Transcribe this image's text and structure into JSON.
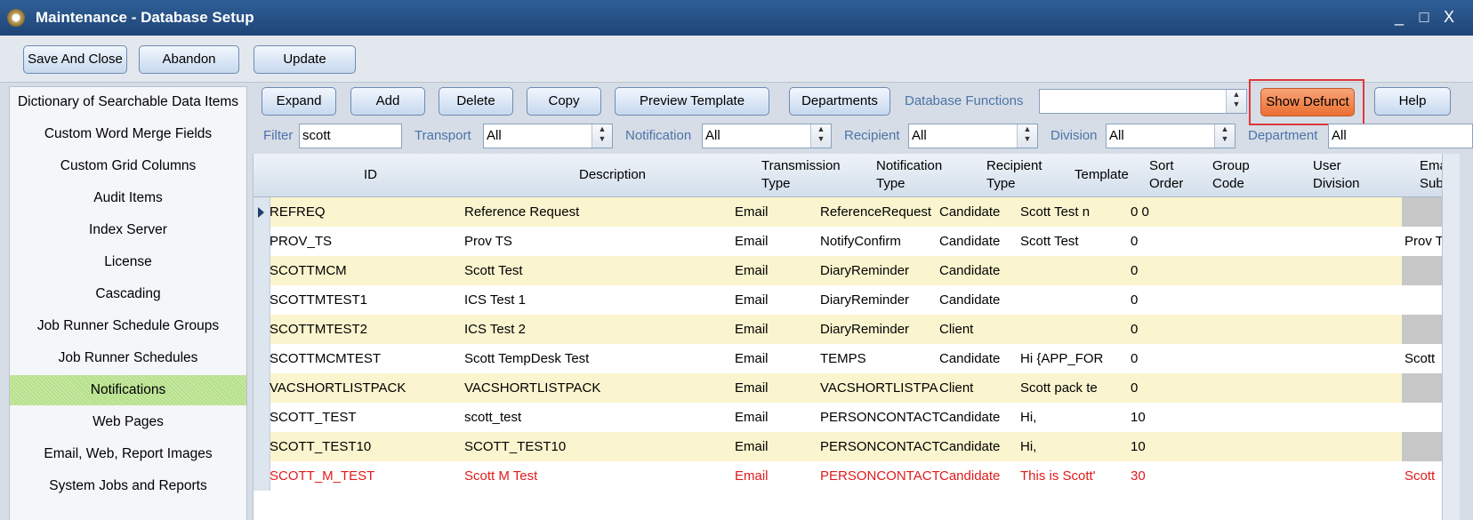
{
  "window": {
    "title": "Maintenance - Database Setup",
    "minimize": "_",
    "maximize": "□",
    "close": "X"
  },
  "toolbar": {
    "save_close": "Save And Close",
    "abandon": "Abandon",
    "update": "Update"
  },
  "nav": {
    "items": [
      "Dictionary of Searchable Data Items",
      "Custom Word Merge Fields",
      "Custom Grid Columns",
      "Audit Items",
      "Index Server",
      "License",
      "Cascading",
      "Job Runner Schedule Groups",
      "Job Runner Schedules",
      "Notifications",
      "Web Pages",
      "Email, Web, Report Images",
      "System Jobs and Reports"
    ],
    "active": "Notifications"
  },
  "actions": {
    "expand": "Expand",
    "add": "Add",
    "delete": "Delete",
    "copy": "Copy",
    "preview": "Preview Template",
    "departments": "Departments",
    "db_functions_label": "Database Functions",
    "db_functions_value": "",
    "show_defunct": "Show Defunct",
    "help": "Help"
  },
  "filters": {
    "filter_label": "Filter",
    "filter_value": "scott",
    "transport_label": "Transport",
    "transport_value": "All",
    "notification_label": "Notification",
    "notification_value": "All",
    "recipient_label": "Recipient",
    "recipient_value": "All",
    "division_label": "Division",
    "division_value": "All",
    "department_label": "Department",
    "department_value": "All"
  },
  "grid": {
    "headers": {
      "id": "ID",
      "description": "Description",
      "transmission_1": "Transmission",
      "transmission_2": "Type",
      "notification_1": "Notification",
      "notification_2": "Type",
      "recipient_1": "Recipient",
      "recipient_2": "Type",
      "template": "Template",
      "sort_1": "Sort",
      "sort_2": "Order",
      "group_1": "Group",
      "group_2": "Code",
      "user_1": "User",
      "user_2": "Division",
      "email_1": "Ema",
      "email_2": "Sub"
    },
    "rows": [
      {
        "id": "REFREQ",
        "description": "Reference Request",
        "transmission": "Email",
        "notification": "ReferenceRequest",
        "recipient": "Candidate",
        "template": "Scott Test  n",
        "sort": "0 0",
        "group": "",
        "user_division": "",
        "email_subject": ""
      },
      {
        "id": "PROV_TS",
        "description": "Prov TS",
        "transmission": "Email",
        "notification": "NotifyConfirm",
        "recipient": "Candidate",
        "template": "Scott Test",
        "sort": "0",
        "group": "",
        "user_division": "",
        "email_subject": "Prov T"
      },
      {
        "id": "SCOTTMCM",
        "description": "Scott Test",
        "transmission": "Email",
        "notification": "DiaryReminder",
        "recipient": "Candidate",
        "template": "",
        "sort": "0",
        "group": "",
        "user_division": "",
        "email_subject": ""
      },
      {
        "id": "SCOTTMTEST1",
        "description": "ICS Test 1",
        "transmission": "Email",
        "notification": "DiaryReminder",
        "recipient": "Candidate",
        "template": "",
        "sort": "0",
        "group": "",
        "user_division": "",
        "email_subject": ""
      },
      {
        "id": "SCOTTMTEST2",
        "description": "ICS Test 2",
        "transmission": "Email",
        "notification": "DiaryReminder",
        "recipient": "Client",
        "template": "",
        "sort": "0",
        "group": "",
        "user_division": "",
        "email_subject": ""
      },
      {
        "id": "SCOTTMCMTEST",
        "description": "Scott TempDesk Test",
        "transmission": "Email",
        "notification": "TEMPS",
        "recipient": "Candidate",
        "template": "Hi {APP_FOR",
        "sort": "0",
        "group": "",
        "user_division": "",
        "email_subject": "Scott"
      },
      {
        "id": "VACSHORTLISTPACK",
        "description": "VACSHORTLISTPACK",
        "transmission": "Email",
        "notification": "VACSHORTLISTPA",
        "recipient": "Client",
        "template": "Scott pack te",
        "sort": "0",
        "group": "",
        "user_division": "",
        "email_subject": ""
      },
      {
        "id": "SCOTT_TEST",
        "description": "scott_test",
        "transmission": "Email",
        "notification": "PERSONCONTACT",
        "recipient": "Candidate",
        "template": "Hi,",
        "sort": "10",
        "group": "",
        "user_division": "",
        "email_subject": ""
      },
      {
        "id": "SCOTT_TEST10",
        "description": "SCOTT_TEST10",
        "transmission": "Email",
        "notification": "PERSONCONTACT",
        "recipient": "Candidate",
        "template": "Hi,",
        "sort": "10",
        "group": "",
        "user_division": "",
        "email_subject": ""
      },
      {
        "id": "SCOTT_M_TEST",
        "description": "Scott M Test",
        "transmission": "Email",
        "notification": "PERSONCONTACT",
        "recipient": "Candidate",
        "template": "This is Scott'",
        "sort": "30",
        "group": "",
        "user_division": "",
        "email_subject": "Scott"
      }
    ],
    "defunct_row": "SCOTT_M_TEST"
  },
  "colors": {
    "title_bar": "#1f4577",
    "row_alt": "#fbf5cf",
    "active_nav": "#b5e088",
    "defunct_text": "#e01b1b",
    "show_defunct_button": "#ec6f33",
    "highlight_box": "#e0373a"
  },
  "icons": {
    "app": "app-logo-icon",
    "row_pointer": "row-pointer-icon",
    "spin": "spinner-arrows-icon"
  }
}
